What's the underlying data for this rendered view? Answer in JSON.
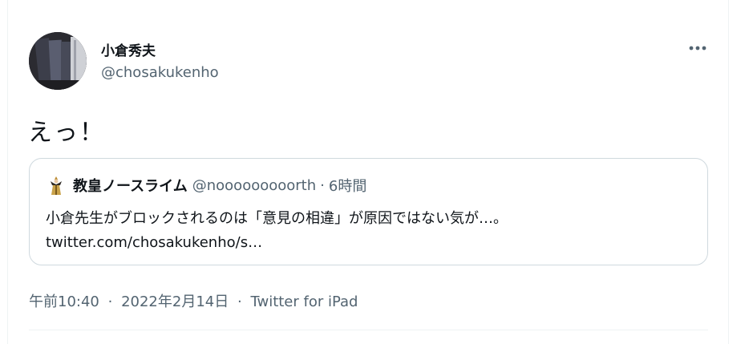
{
  "author": {
    "display_name": "小倉秀夫",
    "handle": "@chosakukenho"
  },
  "tweet": {
    "text": "えっ！"
  },
  "quoted_tweet": {
    "display_name": "教皇ノースライム",
    "handle": "@nooooooooorth",
    "separator": "·",
    "time": "6時間",
    "line1": "小倉先生がブロックされるのは「意見の相違」が原因ではない気が…。",
    "line2": "twitter.com/chosakukenho/s…"
  },
  "meta": {
    "time": "午前10:40",
    "date": "2022年2月14日",
    "client": "Twitter for iPad",
    "separator": "·"
  },
  "icons": {
    "more": "more-horizontal-icon",
    "quoted_avatar": "pope-figure-icon"
  },
  "colors": {
    "text_primary": "#0f1419",
    "text_secondary": "#536471",
    "border": "#cfd9de"
  }
}
